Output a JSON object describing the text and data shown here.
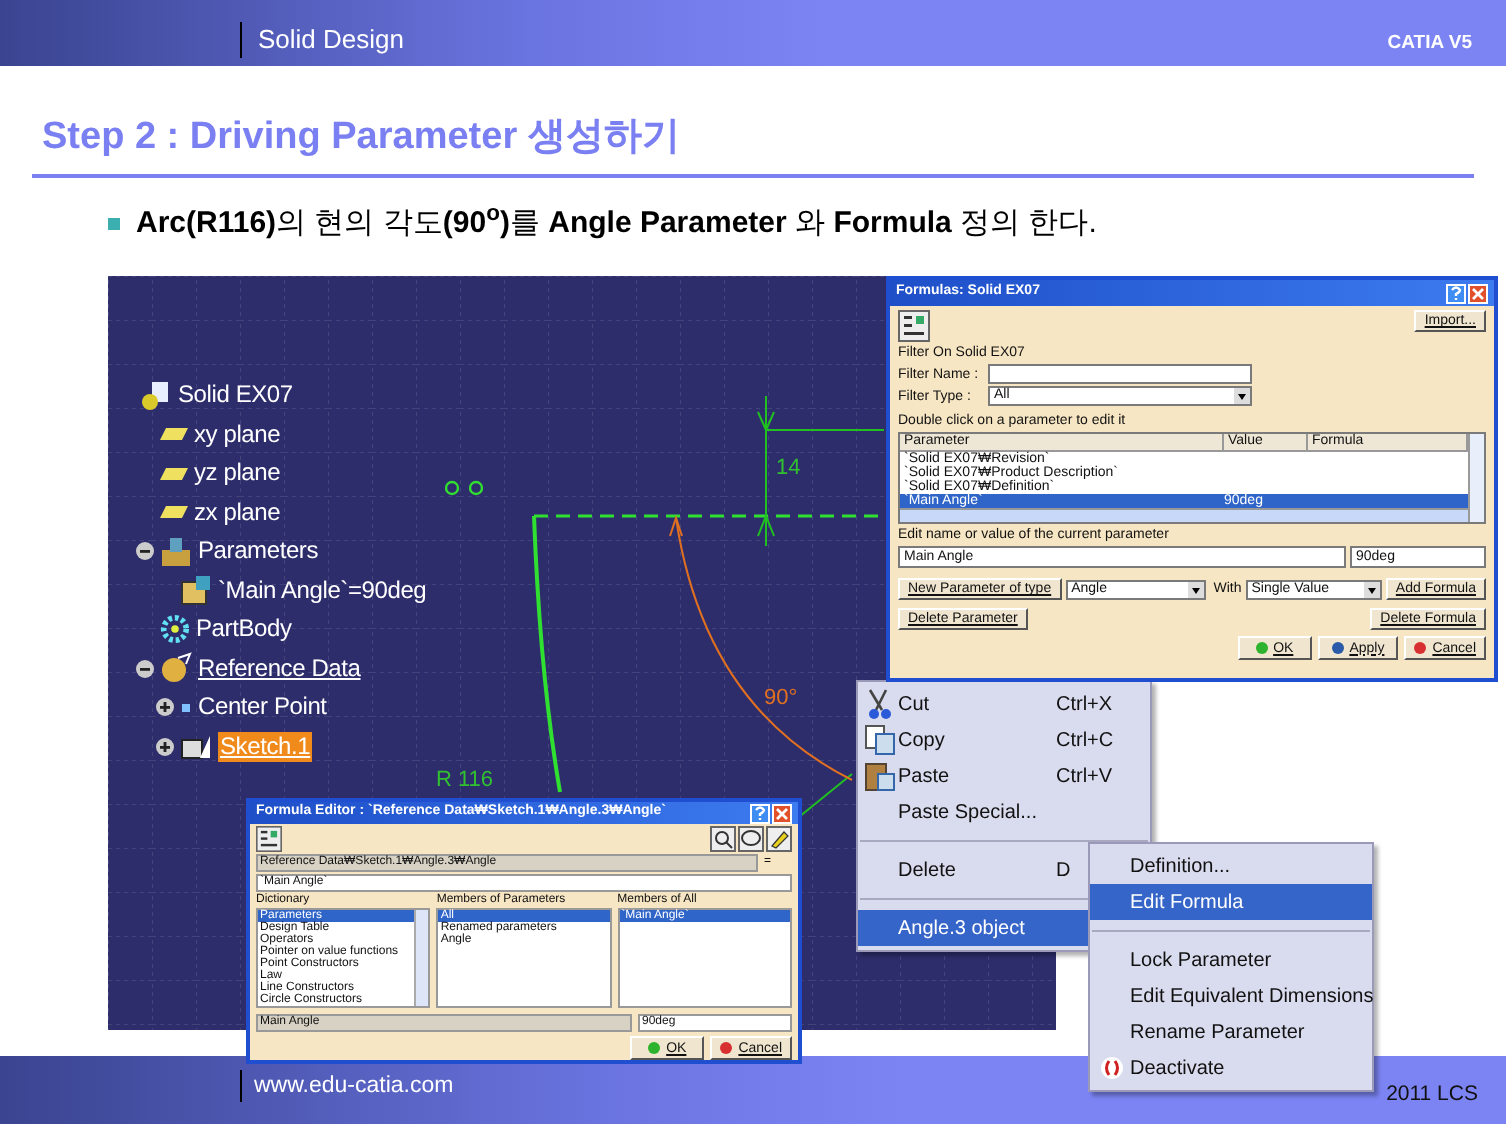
{
  "header": {
    "section": "Solid Design",
    "product": "CATIA V5"
  },
  "title": "Step 2 : Driving Parameter 생성하기",
  "bullet": "**Arc(R116)**의 현의 각도**(90$^{o}$)**를  **Angle Parameter** 와 **Formula** 정의 한다.",
  "tree": [
    {
      "label": "Solid EX07",
      "kind": "part",
      "selected": false,
      "underlined": false,
      "children": [
        {
          "label": "xy plane",
          "kind": "plane",
          "selected": false,
          "underlined": false
        },
        {
          "label": "yz plane",
          "kind": "plane",
          "selected": false,
          "underlined": false
        },
        {
          "label": "zx plane",
          "kind": "plane",
          "selected": false,
          "underlined": false
        },
        {
          "label": "Parameters",
          "kind": "parameters",
          "selected": false,
          "underlined": false,
          "expanded": true,
          "children": [
            {
              "label": "`Main Angle`=90deg",
              "kind": "parameter",
              "selected": false,
              "underlined": false
            }
          ]
        },
        {
          "label": "PartBody",
          "kind": "body",
          "selected": false,
          "underlined": false
        },
        {
          "label": "Reference Data",
          "kind": "reference",
          "selected": false,
          "underlined": true,
          "expanded": true,
          "children": [
            {
              "label": "Center Point",
              "kind": "point",
              "selected": false,
              "underlined": false,
              "expanded": false
            },
            {
              "label": "Sketch.1",
              "kind": "sketch",
              "selected": true,
              "underlined": true,
              "expanded": false
            }
          ]
        }
      ]
    }
  ],
  "sketch": {
    "vertical_dimension": "14",
    "angle_dimension": "90°",
    "radius_dimension": "R 116"
  },
  "formulas_dialog": {
    "title": "Formulas: Solid EX07",
    "import": "Import...",
    "filter_on": "Filter On Solid EX07",
    "filter_name_label": "Filter Name :",
    "filter_type_label": "Filter Type :",
    "filter_type": "All",
    "instruction": "Double click on a parameter to edit it",
    "columns": [
      "Parameter",
      "Value",
      "Formula"
    ],
    "rows": [
      {
        "parameter": "`Solid EX07₩Revision`",
        "selected": false
      },
      {
        "parameter": "`Solid EX07₩Product Description`",
        "selected": false
      },
      {
        "parameter": "`Solid EX07₩Definition`",
        "selected": false
      },
      {
        "parameter": "`Main Angle`",
        "value": "90deg",
        "selected": true
      }
    ],
    "edit_label": "Edit name or value of the current parameter",
    "edit_name": "Main Angle",
    "edit_value": "90deg",
    "new_parameter": "New Parameter of type",
    "parameter_type": "Angle",
    "with_label": "With",
    "with_value": "Single Value",
    "add_formula": "Add Formula",
    "delete_parameter": "Delete Parameter",
    "delete_formula": "Delete Formula",
    "ok": "OK",
    "apply": "Apply",
    "cancel": "Cancel"
  },
  "context_menu": [
    {
      "kind": "item",
      "label": "Cut",
      "shortcut": "Ctrl+X",
      "selected": false
    },
    {
      "kind": "item",
      "label": "Copy",
      "shortcut": "Ctrl+C",
      "selected": false
    },
    {
      "kind": "item",
      "label": "Paste",
      "shortcut": "Ctrl+V",
      "selected": false
    },
    {
      "kind": "item",
      "label": "Paste Special...",
      "selected": false
    },
    {
      "kind": "separator"
    },
    {
      "kind": "item",
      "label": "Delete",
      "shortcut": "D",
      "selected": false
    },
    {
      "kind": "separator"
    },
    {
      "kind": "item",
      "label": "Angle.3 object",
      "selected": true
    }
  ],
  "submenu": [
    {
      "kind": "item",
      "label": "Definition...",
      "selected": false
    },
    {
      "kind": "item",
      "label": "Edit Formula",
      "selected": true
    },
    {
      "kind": "separator"
    },
    {
      "kind": "item",
      "label": "Lock Parameter",
      "selected": false
    },
    {
      "kind": "item",
      "label": "Edit Equivalent Dimensions",
      "selected": false
    },
    {
      "kind": "item",
      "label": "Rename Parameter",
      "selected": false
    },
    {
      "kind": "item",
      "label": "Deactivate",
      "selected": false
    }
  ],
  "formula_editor": {
    "title": "Formula Editor : `Reference Data₩Sketch.1₩Angle.3₩Angle`",
    "path": "Reference Data₩Sketch.1₩Angle.3₩Angle",
    "equals": "=",
    "formula": "`Main Angle`",
    "lists": [
      {
        "heading": "Dictionary",
        "items": [
          {
            "label": "Parameters",
            "selected": true
          },
          {
            "label": "Design Table",
            "selected": false
          },
          {
            "label": "Operators",
            "selected": false
          },
          {
            "label": "Pointer on value functions",
            "selected": false
          },
          {
            "label": "Point Constructors",
            "selected": false
          },
          {
            "label": "Law",
            "selected": false
          },
          {
            "label": "Line Constructors",
            "selected": false
          },
          {
            "label": "Circle Constructors",
            "selected": false
          }
        ]
      },
      {
        "heading": "Members of Parameters",
        "items": [
          {
            "label": "All",
            "selected": true
          },
          {
            "label": "Renamed parameters",
            "selected": false
          },
          {
            "label": "Angle",
            "selected": false
          }
        ]
      },
      {
        "heading": "Members of All",
        "items": [
          {
            "label": "`Main Angle`",
            "selected": true
          }
        ]
      }
    ],
    "bottom_name": "Main Angle",
    "bottom_value": "90deg",
    "ok": "OK",
    "cancel": "Cancel"
  },
  "footer": {
    "url": "www.edu-catia.com",
    "copyright": "2011 LCS"
  }
}
